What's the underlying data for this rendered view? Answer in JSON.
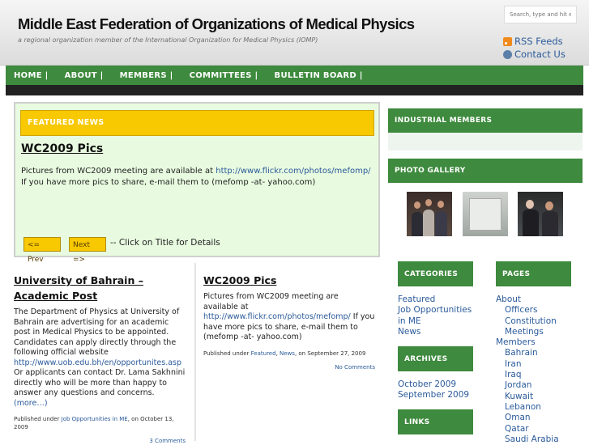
{
  "header": {
    "title": "Middle East Federation of Organizations of Medical Physics",
    "description": "a regional organization member of the International Organization for Medical Physics (IOMP)",
    "search_placeholder": "Search, type and hit ent",
    "rss_label": "RSS Feeds",
    "contact_label": "Contact Us"
  },
  "nav": [
    "HOME |",
    "ABOUT |",
    "MEMBERS |",
    "COMMITTEES |",
    "BULLETIN BOARD |"
  ],
  "featured": {
    "heading": "FEATURED NEWS",
    "title": "WC2009 Pics",
    "text_before_link": "Pictures from WC2009 meeting are available at ",
    "link": "http://www.flickr.com/photos/mefomp/",
    "text_after_link": " If you have more pics to share, e-mail them to (mefomp -at- yahoo.com)",
    "prev_label": "<= Prev",
    "next_label": "Next =>",
    "hint": "-- Click on Title for Details"
  },
  "posts": [
    {
      "title": "University of Bahrain – Academic Post",
      "body_before_link": "The Department of Physics at University of Bahrain are advertising for an academic post in Medical Physics to be appointed. Candidates can apply directly through the following official website ",
      "link": "http://www.uob.edu.bh/en/opportunites.asp",
      "body_after_link": " Or applicants can contact Dr. Lama Sakhnini directly who will be more than happy to answer any questions and concerns.",
      "more": "(more…)",
      "meta_prefix": "Published under ",
      "categories": "Job Opportunities in ME",
      "date": ", on October 13, 2009",
      "comments": "3 Comments"
    },
    {
      "title": "WC2009 Pics",
      "body_before_link": "Pictures from WC2009 meeting are available at ",
      "link": "http://www.flickr.com/photos/mefomp/",
      "body_after_link": " If you have more pics to share, e-mail them to (mefomp -at- yahoo.com)",
      "meta_prefix": "Published under ",
      "cat1": "Featured",
      "sep": ", ",
      "cat2": "News",
      "date": ", on September 27, 2009",
      "comments": "No Comments"
    }
  ],
  "sidebar": {
    "industrial_heading": "INDUSTRIAL MEMBERS",
    "gallery_heading": "PHOTO GALLERY",
    "categories_heading": "CATEGORIES",
    "categories": [
      "Featured",
      "Job Opportunities in ME",
      "News"
    ],
    "archives_heading": "ARCHIVES",
    "archives": [
      "October 2009",
      "September 2009"
    ],
    "links_heading": "LINKS",
    "pages_heading": "PAGES",
    "pages": [
      {
        "label": "About",
        "sub": false
      },
      {
        "label": "Officers",
        "sub": true
      },
      {
        "label": "Constitution",
        "sub": true
      },
      {
        "label": "Meetings",
        "sub": true
      },
      {
        "label": "Members",
        "sub": false
      },
      {
        "label": "Bahrain",
        "sub": true
      },
      {
        "label": "Iran",
        "sub": true
      },
      {
        "label": "Iraq",
        "sub": true
      },
      {
        "label": "Jordan",
        "sub": true
      },
      {
        "label": "Kuwait",
        "sub": true
      },
      {
        "label": "Lebanon",
        "sub": true
      },
      {
        "label": "Oman",
        "sub": true
      },
      {
        "label": "Qatar",
        "sub": true
      },
      {
        "label": "Saudi Arabia",
        "sub": true
      }
    ]
  },
  "icons": {
    "rss": "rss-icon",
    "contact": "contact-icon"
  },
  "colors": {
    "nav_green": "#3e8a3e",
    "featured_yellow": "#f8c800",
    "featured_bg": "#e8fbe0",
    "link_blue": "#2a5a9a"
  }
}
